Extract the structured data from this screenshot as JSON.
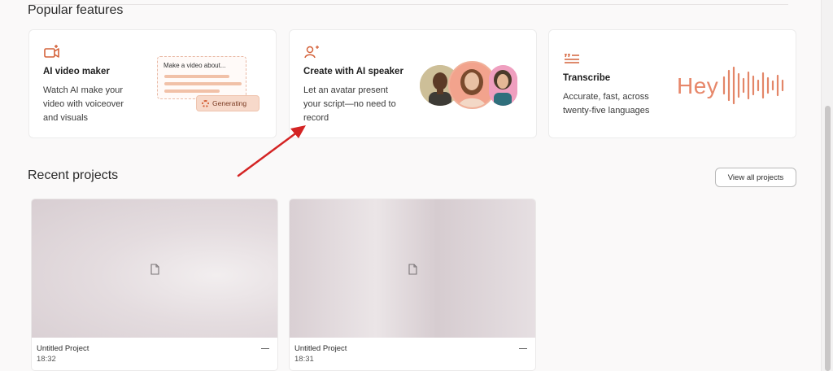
{
  "popular": {
    "title": "Popular features",
    "cards": [
      {
        "title": "AI video maker",
        "desc1": "Watch AI make your",
        "desc2": "video with voiceover",
        "desc3": "and visuals",
        "prompt": "Make a video about...",
        "status": "Generating",
        "icon": "video-plus-icon"
      },
      {
        "title": "Create with AI speaker",
        "desc1": "Let an avatar present",
        "desc2": "your script—no need to",
        "desc3": "record",
        "icon": "person-sparkle-icon"
      },
      {
        "title": "Transcribe",
        "desc1": "Accurate, fast, across",
        "desc2": "twenty-five languages",
        "logo_text": "Hey",
        "icon": "quote-lines-icon"
      }
    ]
  },
  "recent": {
    "title": "Recent projects",
    "view_all": "View all projects",
    "projects": [
      {
        "name": "Untitled Project",
        "time": "18:32"
      },
      {
        "name": "Untitled Project",
        "time": "18:31"
      }
    ]
  },
  "colors": {
    "accent": "#d4623a",
    "accent_light": "#f7d9ca",
    "annotation_arrow": "#d42424"
  }
}
